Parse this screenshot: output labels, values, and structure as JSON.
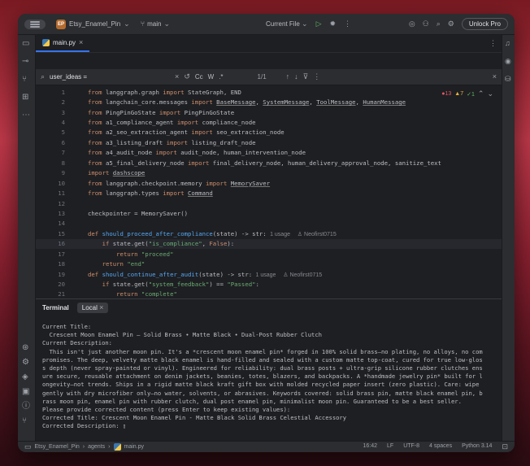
{
  "titlebar": {
    "project_badge": "EP",
    "project_name": "Etsy_Enamel_Pin",
    "branch": "main",
    "run_config": "Current File",
    "unlock_label": "Unlock Pro"
  },
  "editor": {
    "tab_label": "main.py",
    "find_query": "user_ideas =",
    "find_case": "Cc",
    "find_word": "W",
    "find_regex": ".*",
    "find_count": "1/1",
    "inspections": {
      "errors": "13",
      "warnings": "7",
      "ok": "1"
    },
    "lines": [
      {
        "n": "1"
      },
      {
        "n": "2"
      },
      {
        "n": "3"
      },
      {
        "n": "4"
      },
      {
        "n": "5"
      },
      {
        "n": "6"
      },
      {
        "n": "7"
      },
      {
        "n": "8"
      },
      {
        "n": "9"
      },
      {
        "n": "10"
      },
      {
        "n": "11"
      },
      {
        "n": "12"
      },
      {
        "n": "13"
      },
      {
        "n": "14"
      },
      {
        "n": "15"
      },
      {
        "n": "16"
      },
      {
        "n": "17"
      },
      {
        "n": "18"
      },
      {
        "n": "19"
      },
      {
        "n": "20"
      },
      {
        "n": "21"
      }
    ],
    "hints": {
      "usage": "1 usage",
      "author": "Neofirst0715"
    }
  },
  "terminal": {
    "tab_terminal": "Terminal",
    "tab_local": "Local",
    "lines": [
      "Current Title:",
      "  Crescent Moon Enamel Pin — Solid Brass • Matte Black • Dual-Post Rubber Clutch",
      "",
      "Current Description:",
      "  This isn't just another moon pin. It's a *crescent moon enamel pin* forged in 100% solid brass—no plating, no alloys, no com",
      "promises. The deep, velvety matte black enamel is hand-filled and sealed with a custom matte top-coat, cured for true low-glos",
      "s depth (never spray-painted or vinyl). Engineered for reliability: dual brass posts + ultra-grip silicone rubber clutches ens",
      "ure secure, reusable attachment on denim jackets, beanies, totes, blazers, and backpacks. A *handmade jewelry pin* built for l",
      "ongevity—not trends. Ships in a rigid matte black kraft gift box with molded recycled paper insert (zero plastic). Care: wipe",
      "gently with dry microfiber only—no water, solvents, or abrasives. Keywords covered: solid brass pin, matte black enamel pin, b",
      "rass moon pin, enamel pin with rubber clutch, dual post enamel pin, minimalist moon pin. Guaranteed to be a best seller.",
      "",
      "Please provide corrected content (press Enter to keep existing values):",
      "Corrected Title: Crescent Moon Enamel Pin - Matte Black Solid Brass Celestial Accessory",
      "Corrected Description: ▯"
    ]
  },
  "status": {
    "crumb_project": "Etsy_Enamel_Pin",
    "crumb_dir": "agents",
    "crumb_file": "main.py",
    "position": "16:42",
    "line_sep": "LF",
    "encoding": "UTF-8",
    "indent": "4 spaces",
    "interpreter": "Python 3.14"
  },
  "colors": {
    "accent": "#3574f0",
    "keyword": "#cf8e6d",
    "string": "#6aab73",
    "function": "#56a8f5"
  }
}
